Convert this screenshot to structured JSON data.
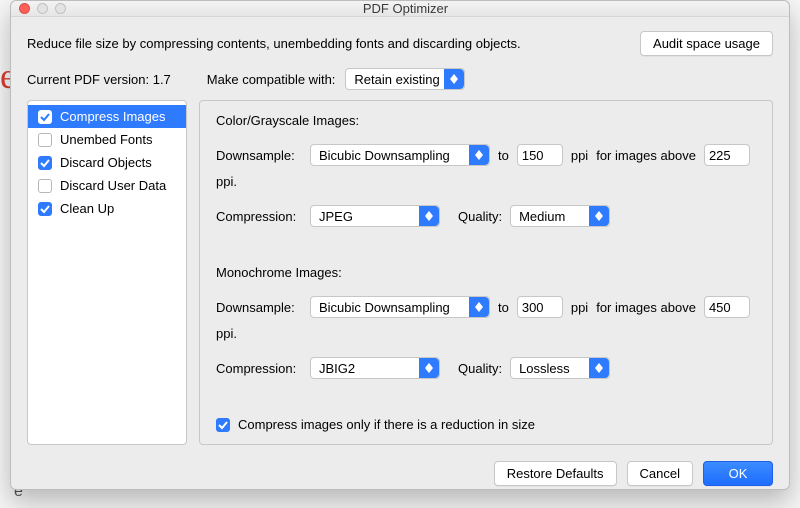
{
  "window": {
    "title": "PDF Optimizer"
  },
  "header": {
    "description": "Reduce file size by compressing contents, unembedding fonts and discarding objects.",
    "audit_button": "Audit space usage",
    "version_label": "Current PDF version:",
    "version_value": "1.7",
    "compat_label": "Make compatible with:",
    "compat_value": "Retain existing"
  },
  "sidebar": {
    "items": [
      {
        "label": "Compress Images",
        "checked": true,
        "selected": true
      },
      {
        "label": "Unembed Fonts",
        "checked": false,
        "selected": false
      },
      {
        "label": "Discard Objects",
        "checked": true,
        "selected": false
      },
      {
        "label": "Discard User Data",
        "checked": false,
        "selected": false
      },
      {
        "label": "Clean Up",
        "checked": true,
        "selected": false
      }
    ]
  },
  "content": {
    "color_section_title": "Color/Grayscale Images:",
    "mono_section_title": "Monochrome Images:",
    "labels": {
      "downsample": "Downsample:",
      "compression": "Compression:",
      "quality": "Quality:",
      "to": "to",
      "ppi": "ppi",
      "for_above": "for images above",
      "ppi_end": "ppi."
    },
    "color": {
      "downsample_method": "Bicubic Downsampling",
      "target_ppi": "150",
      "above_ppi": "225",
      "compression": "JPEG",
      "quality": "Medium"
    },
    "mono": {
      "downsample_method": "Bicubic Downsampling",
      "target_ppi": "300",
      "above_ppi": "450",
      "compression": "JBIG2",
      "quality": "Lossless"
    },
    "only_if_reduction": {
      "checked": true,
      "label": "Compress images only if there is a reduction in size"
    }
  },
  "footer": {
    "restore": "Restore Defaults",
    "cancel": "Cancel",
    "ok": "OK"
  }
}
